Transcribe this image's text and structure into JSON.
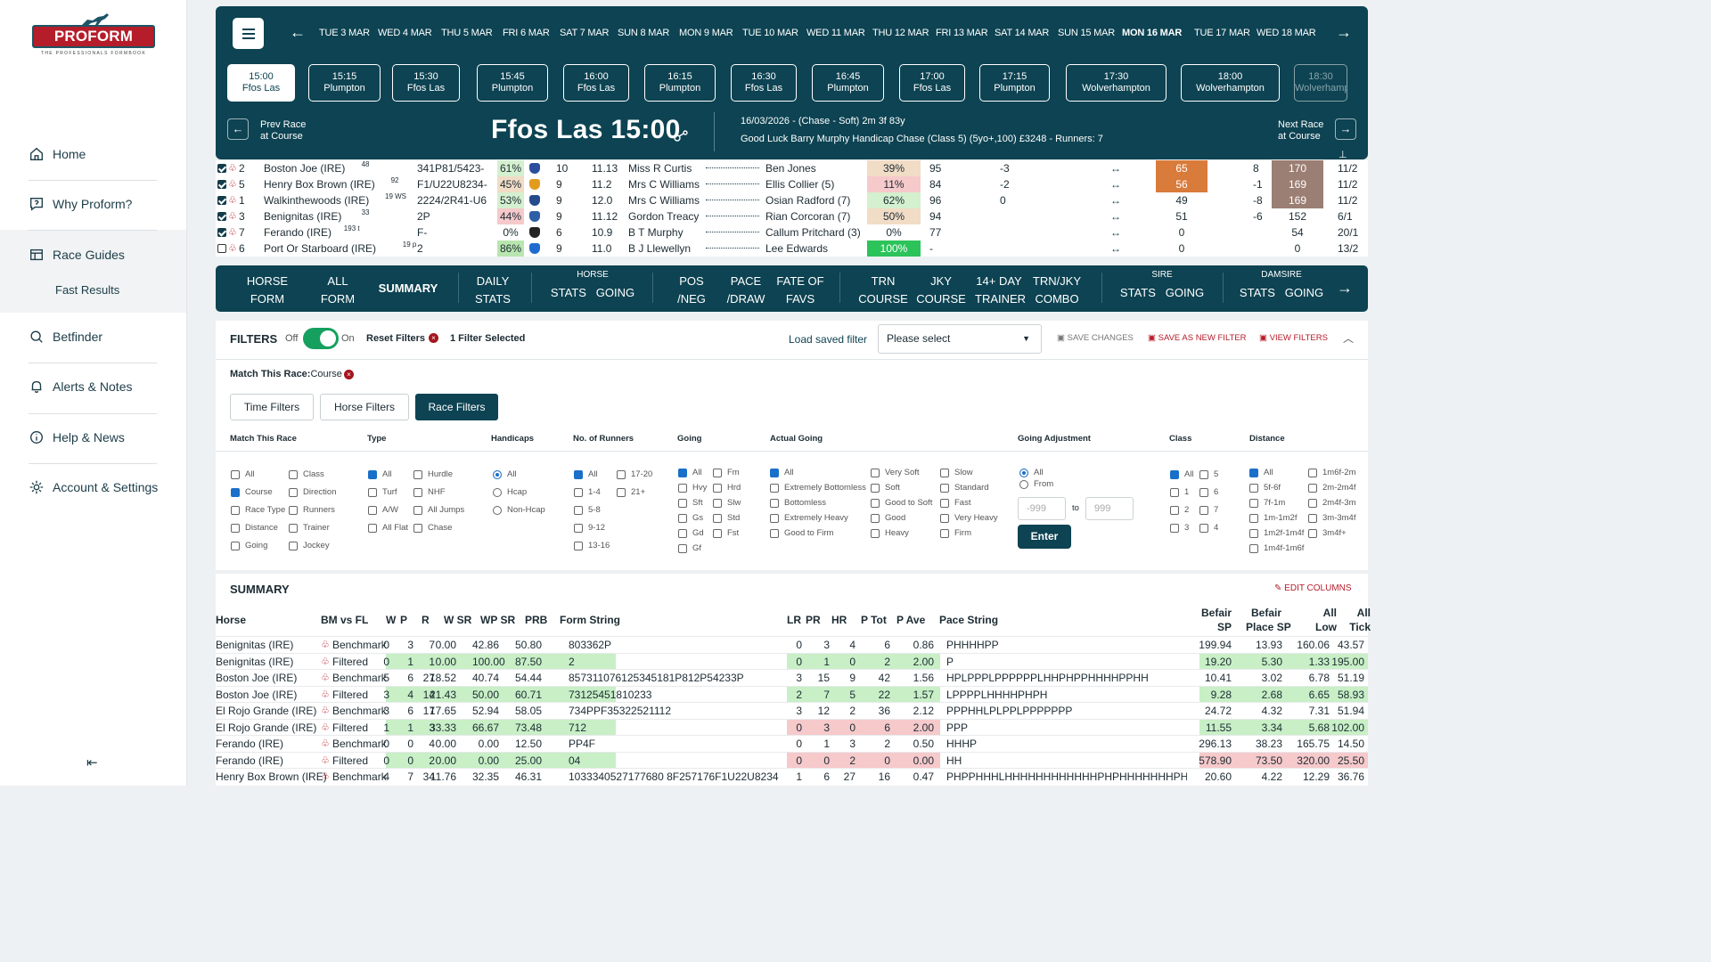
{
  "brand": {
    "name": "PROFORM RACING",
    "tagline": "THE PROFESSIONALS FORMBOOK"
  },
  "nav": {
    "home": "Home",
    "why": "Why Proform?",
    "guides": "Race Guides",
    "fast": "Fast Results",
    "betfinder": "Betfinder",
    "alerts": "Alerts & Notes",
    "help": "Help & News",
    "account": "Account & Settings",
    "collapse": "⇤"
  },
  "dates": [
    "TUE 3 MAR",
    "WED 4 MAR",
    "THU 5 MAR",
    "FRI 6 MAR",
    "SAT 7 MAR",
    "SUN 8 MAR",
    "MON 9 MAR",
    "TUE 10 MAR",
    "WED 11 MAR",
    "THU 12 MAR",
    "FRI 13 MAR",
    "SAT 14 MAR",
    "SUN 15 MAR",
    "MON 16 MAR",
    "TUE 17 MAR",
    "WED 18 MAR"
  ],
  "selected_date": "MON 16 MAR",
  "races": [
    {
      "time": "15:00",
      "course": "Ffos Las"
    },
    {
      "time": "15:15",
      "course": "Plumpton"
    },
    {
      "time": "15:30",
      "course": "Ffos Las"
    },
    {
      "time": "15:45",
      "course": "Plumpton"
    },
    {
      "time": "16:00",
      "course": "Ffos Las"
    },
    {
      "time": "16:15",
      "course": "Plumpton"
    },
    {
      "time": "16:30",
      "course": "Ffos Las"
    },
    {
      "time": "16:45",
      "course": "Plumpton"
    },
    {
      "time": "17:00",
      "course": "Ffos Las"
    },
    {
      "time": "17:15",
      "course": "Plumpton"
    },
    {
      "time": "17:30",
      "course": "Wolverhampton"
    },
    {
      "time": "18:00",
      "course": "Wolverhampton"
    },
    {
      "time": "18:30",
      "course": "Wolverhampton"
    }
  ],
  "race_header": {
    "prev_l1": "Prev Race",
    "prev_l2": "at Course",
    "title": "Ffos Las 15:00",
    "info1": "16/03/2026 - (Chase - Soft) 2m 3f 83y",
    "info2": "Good Luck Barry Murphy Handicap Chase (Class 5) (5yo+,100) £3248 - Runners: 7",
    "next_l1": "Next Race",
    "next_l2": "at Course"
  },
  "runners": [
    {
      "checked": true,
      "no": "2",
      "horse": "Boston Joe (IRE)",
      "sup": "48",
      "form": "341P81/5423-",
      "pct": "61%",
      "age": "10",
      "wt": "11.13",
      "trainer": "Miss R Curtis",
      "jockey": "Ben Jones",
      "jpct": "39%",
      "or": "95",
      "chg": "-3",
      "v1": "65",
      "v2": "8",
      "v3": "170",
      "sp": "11/2"
    },
    {
      "checked": true,
      "no": "5",
      "horse": "Henry Box Brown (IRE)",
      "sup": "92",
      "form": "F1/U22U8234-",
      "pct": "45%",
      "age": "9",
      "wt": "11.2",
      "trainer": "Mrs C Williams",
      "jockey": "Ellis Collier (5)",
      "jpct": "11%",
      "or": "84",
      "chg": "-2",
      "v1": "56",
      "v2": "-1",
      "v3": "169",
      "sp": "11/2"
    },
    {
      "checked": true,
      "no": "1",
      "horse": "Walkinthewoods (IRE)",
      "sup": "19 WS",
      "form": "2224/2R41-U6",
      "pct": "53%",
      "age": "9",
      "wt": "12.0",
      "trainer": "Mrs C Williams",
      "jockey": "Osian Radford (7)",
      "jpct": "62%",
      "or": "96",
      "chg": "0",
      "v1": "49",
      "v2": "-8",
      "v3": "169",
      "sp": "11/2"
    },
    {
      "checked": true,
      "no": "3",
      "horse": "Benignitas (IRE)",
      "sup": "33",
      "form": "2P",
      "pct": "44%",
      "age": "9",
      "wt": "11.12",
      "trainer": "Gordon Treacy",
      "jockey": "Rian Corcoran (7)",
      "jpct": "50%",
      "or": "94",
      "chg": "",
      "v1": "51",
      "v2": "-6",
      "v3": "152",
      "sp": "6/1"
    },
    {
      "checked": true,
      "no": "7",
      "horse": "Ferando (IRE)",
      "sup": "193 t",
      "form": "F-",
      "pct": "0%",
      "age": "6",
      "wt": "10.9",
      "trainer": "B T Murphy",
      "jockey": "Callum Pritchard (3)",
      "jpct": "0%",
      "or": "77",
      "chg": "",
      "v1": "0",
      "v2": "",
      "v3": "54",
      "sp": "20/1"
    },
    {
      "checked": false,
      "no": "6",
      "horse": "Port Or Starboard (IRE)",
      "sup": "19 p",
      "form": "2",
      "pct": "86%",
      "age": "9",
      "wt": "11.0",
      "trainer": "B J Llewellyn",
      "jockey": "Lee Edwards",
      "jpct": "100%",
      "or": "-",
      "chg": "",
      "v1": "0",
      "v2": "",
      "v3": "0",
      "sp": "13/2"
    }
  ],
  "tabs": {
    "horse_form_1": "HORSE",
    "horse_form_2": "FORM",
    "all_form_1": "ALL",
    "all_form_2": "FORM",
    "summary": "SUMMARY",
    "daily_1": "DAILY",
    "daily_2": "STATS",
    "horse_grp": "HORSE",
    "horse_stats": "STATS",
    "horse_going": "GOING",
    "pos_1": "POS",
    "pos_2": "/NEG",
    "pace_1": "PACE",
    "pace_2": "/DRAW",
    "fate_1": "FATE OF",
    "fate_2": "FAVS",
    "trn_1": "TRN",
    "trn_2": "COURSE",
    "jky_1": "JKY",
    "jky_2": "COURSE",
    "d14_1": "14+ DAY",
    "d14_2": "TRAINER",
    "trnjky_1": "TRN/JKY",
    "trnjky_2": "COMBO",
    "sire_grp": "SIRE",
    "sire_stats": "STATS",
    "sire_going": "GOING",
    "dam_grp": "DAMSIRE",
    "dam_stats": "STATS",
    "dam_going": "GOING"
  },
  "filters": {
    "title": "FILTERS",
    "off": "Off",
    "on": "On",
    "reset": "Reset Filters",
    "selected": "1 Filter Selected",
    "load": "Load saved filter",
    "select_placeholder": "Please select",
    "save": "SAVE CHANGES",
    "save_new": "SAVE AS NEW FILTER",
    "view": "VIEW FILTERS",
    "match": "Match This Race:",
    "match_val": "Course",
    "btn_time": "Time Filters",
    "btn_horse": "Horse Filters",
    "btn_race": "Race Filters",
    "headers": {
      "match": "Match This Race",
      "type": "Type",
      "handicaps": "Handicaps",
      "runners": "No. of Runners",
      "going": "Going",
      "actual": "Actual Going",
      "adjust": "Going Adjustment",
      "class": "Class",
      "distance": "Distance"
    },
    "match_opts": [
      "All",
      "Class",
      "Course",
      "Direction",
      "Race Type",
      "Runners",
      "Distance",
      "Trainer",
      "Going",
      "Jockey"
    ],
    "type_opts": [
      "All",
      "Hurdle",
      "Turf",
      "NHF",
      "A/W",
      "All Jumps",
      "All Flat",
      "Chase"
    ],
    "hcap_opts": [
      "All",
      "Hcap",
      "Non-Hcap"
    ],
    "runner_opts": [
      "All",
      "17-20",
      "1-4",
      "21+",
      "5-8",
      "9-12",
      "13-16"
    ],
    "going_opts": [
      "All",
      "Fm",
      "Hvy",
      "Hrd",
      "Sft",
      "Slw",
      "Gs",
      "Std",
      "Gd",
      "Fst",
      "Gf"
    ],
    "actual_opts": [
      "All",
      "Very Soft",
      "Slow",
      "Extremely Bottomless",
      "Soft",
      "Standard",
      "Bottomless",
      "Good to Soft",
      "Fast",
      "Extremely Heavy",
      "Good",
      "Very Heavy",
      "Good to Firm",
      "Heavy",
      "Firm"
    ],
    "adjust_opts": [
      "All",
      "From"
    ],
    "adj_from": "-999",
    "adj_to": "999",
    "to": "to",
    "enter": "Enter",
    "class_opts": [
      "All",
      "5",
      "1",
      "6",
      "2",
      "7",
      "3",
      "4"
    ],
    "dist_opts": [
      "All",
      "1m6f-2m",
      "5f-6f",
      "2m-2m4f",
      "7f-1m",
      "2m4f-3m",
      "1m-1m2f",
      "3m-3m4f",
      "1m2f-1m4f",
      "3m4f+",
      "1m4f-1m6f"
    ]
  },
  "summary": {
    "title": "SUMMARY",
    "edit": "EDIT COLUMNS",
    "cols": {
      "horse": "Horse",
      "bm": "BM vs FL",
      "w": "W",
      "p": "P",
      "r": "R",
      "wsr": "W SR",
      "wpsr": "WP SR",
      "prb": "PRB",
      "form": "Form String",
      "lr": "LR",
      "pr": "PR",
      "hr": "HR",
      "ptot": "P Tot",
      "pave": "P Ave",
      "pace": "Pace String",
      "bsp_1": "Befair",
      "bsp_2": "SP",
      "bpsp_1": "Befair",
      "bpsp_2": "Place SP",
      "alow_1": "All",
      "alow_2": "Low",
      "atick_1": "All",
      "atick_2": "Tick"
    },
    "rows": [
      {
        "horse": "Benignitas (IRE)",
        "type": "Benchmark",
        "w": "0",
        "p": "3",
        "r": "7",
        "wsr": "0.00",
        "wpsr": "42.86",
        "prb": "50.80",
        "form": "803362P",
        "lr": "0",
        "pr": "3",
        "hr": "4",
        "ptot": "6",
        "pave": "0.86",
        "pace": "PHHHHPP",
        "bsp": "199.94",
        "bpsp": "13.93",
        "alow": "160.06",
        "atick": "43.57"
      },
      {
        "horse": "Benignitas (IRE)",
        "type": "Filtered",
        "w": "0",
        "p": "1",
        "r": "1",
        "wsr": "0.00",
        "wpsr": "100.00",
        "prb": "87.50",
        "form": "2",
        "lr": "0",
        "pr": "1",
        "hr": "0",
        "ptot": "2",
        "pave": "2.00",
        "pace": "P",
        "bsp": "19.20",
        "bpsp": "5.30",
        "alow": "1.33",
        "atick": "195.00"
      },
      {
        "horse": "Boston Joe (IRE)",
        "type": "Benchmark",
        "w": "5",
        "p": "6",
        "r": "27",
        "wsr": "18.52",
        "wpsr": "40.74",
        "prb": "54.44",
        "form": "857311076125345181P812P54233P",
        "lr": "3",
        "pr": "15",
        "hr": "9",
        "ptot": "42",
        "pave": "1.56",
        "pace": "HPLPPPLPPPPPPLHHPHPPHHHHPPHH",
        "bsp": "10.41",
        "bpsp": "3.02",
        "alow": "6.78",
        "atick": "51.19"
      },
      {
        "horse": "Boston Joe (IRE)",
        "type": "Filtered",
        "w": "3",
        "p": "4",
        "r": "14",
        "wsr": "21.43",
        "wpsr": "50.00",
        "prb": "60.71",
        "form": "73125451810233",
        "lr": "2",
        "pr": "7",
        "hr": "5",
        "ptot": "22",
        "pave": "1.57",
        "pace": "LPPPPLHHHHPHPH",
        "bsp": "9.28",
        "bpsp": "2.68",
        "alow": "6.65",
        "atick": "58.93"
      },
      {
        "horse": "El Rojo Grande (IRE)",
        "type": "Benchmark",
        "w": "3",
        "p": "6",
        "r": "17",
        "wsr": "17.65",
        "wpsr": "52.94",
        "prb": "58.05",
        "form": "734PPF35322521112",
        "lr": "3",
        "pr": "12",
        "hr": "2",
        "ptot": "36",
        "pave": "2.12",
        "pace": "PPPHHLPLPPLPPPPPPP",
        "bsp": "24.72",
        "bpsp": "4.32",
        "alow": "7.31",
        "atick": "51.94"
      },
      {
        "horse": "El Rojo Grande (IRE)",
        "type": "Filtered",
        "w": "1",
        "p": "1",
        "r": "3",
        "wsr": "33.33",
        "wpsr": "66.67",
        "prb": "73.48",
        "form": "712",
        "lr": "0",
        "pr": "3",
        "hr": "0",
        "ptot": "6",
        "pave": "2.00",
        "pace": "PPP",
        "bsp": "11.55",
        "bpsp": "3.34",
        "alow": "5.68",
        "atick": "102.00"
      },
      {
        "horse": "Ferando (IRE)",
        "type": "Benchmark",
        "w": "0",
        "p": "0",
        "r": "4",
        "wsr": "0.00",
        "wpsr": "0.00",
        "prb": "12.50",
        "form": "PP4F",
        "lr": "0",
        "pr": "1",
        "hr": "3",
        "ptot": "2",
        "pave": "0.50",
        "pace": "HHHP",
        "bsp": "296.13",
        "bpsp": "38.23",
        "alow": "165.75",
        "atick": "14.50"
      },
      {
        "horse": "Ferando (IRE)",
        "type": "Filtered",
        "w": "0",
        "p": "0",
        "r": "2",
        "wsr": "0.00",
        "wpsr": "0.00",
        "prb": "25.00",
        "form": "04",
        "lr": "0",
        "pr": "0",
        "hr": "2",
        "ptot": "0",
        "pave": "0.00",
        "pace": "HH",
        "bsp": "578.90",
        "bpsp": "73.50",
        "alow": "320.00",
        "atick": "25.50"
      },
      {
        "horse": "Henry Box Brown (IRE)",
        "type": "Benchmark",
        "w": "4",
        "p": "7",
        "r": "34",
        "wsr": "11.76",
        "wpsr": "32.35",
        "prb": "46.31",
        "form": "1033340527177680 8F257176F1U22U8234",
        "lr": "1",
        "pr": "6",
        "hr": "27",
        "ptot": "16",
        "pave": "0.47",
        "pace": "PHPPHHHLHHHHHHHHHHHHPHPHHHHHHHPHP",
        "bsp": "20.60",
        "bpsp": "4.22",
        "alow": "12.29",
        "atick": "36.76"
      }
    ]
  }
}
